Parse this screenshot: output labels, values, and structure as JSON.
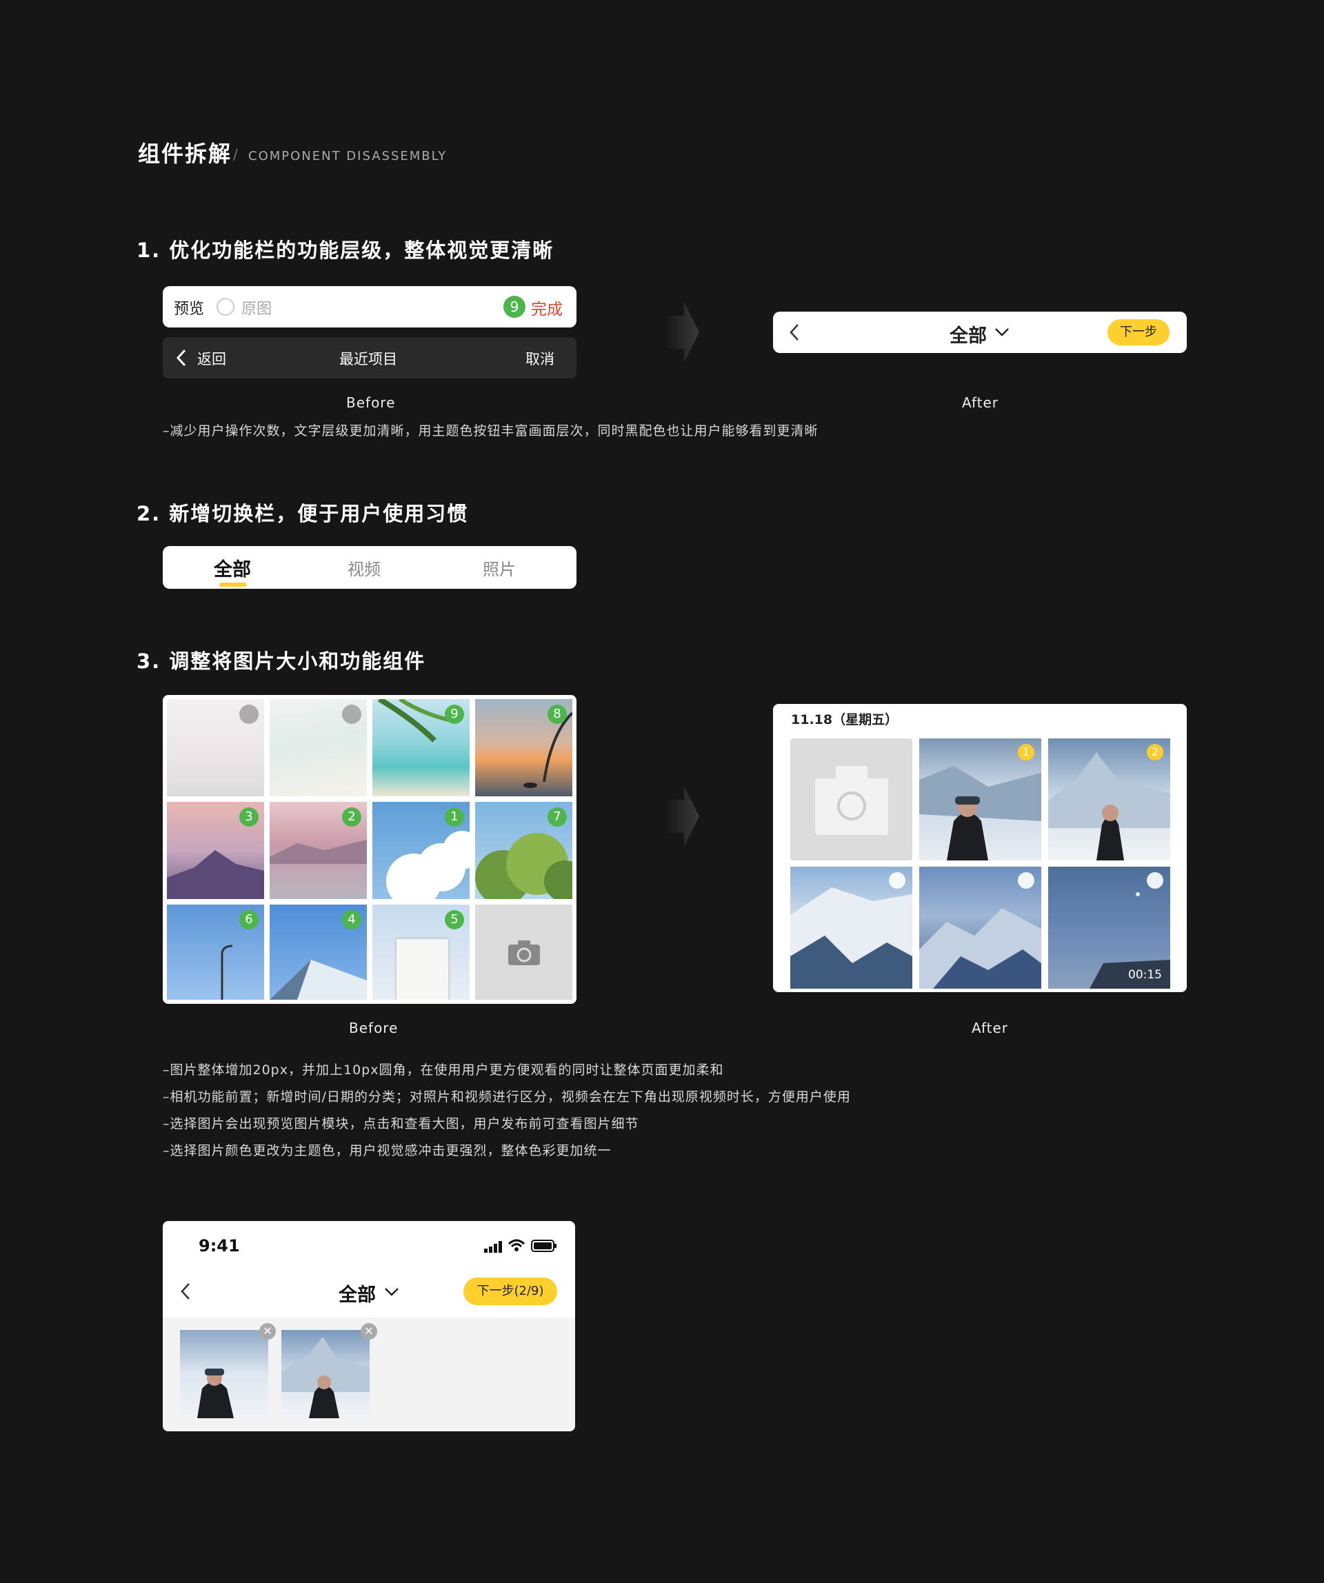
{
  "header": {
    "title": "组件拆解",
    "slash": "/",
    "subtitle": "COMPONENT DISASSEMBLY"
  },
  "section1": {
    "heading": "1. 优化功能栏的功能层级，整体视觉更清晰",
    "before": {
      "preview": "预览",
      "original": "原图",
      "count": "9",
      "done": "完成",
      "back": "返回",
      "recent": "最近项目",
      "cancel": "取消"
    },
    "after": {
      "title": "全部",
      "next": "下一步"
    },
    "before_caption": "Before",
    "after_caption": "After",
    "note": "–减少用户操作次数，文字层级更加清晰，用主题色按钮丰富画面层次，同时黑配色也让用户能够看到更清晰"
  },
  "section2": {
    "heading": "2. 新增切换栏，便于用户使用习惯",
    "tabs": [
      "全部",
      "视频",
      "照片"
    ]
  },
  "section3": {
    "heading": "3. 调整将图片大小和功能组件",
    "before_badges": [
      "",
      "",
      "9",
      "8",
      "3",
      "2",
      "1",
      "7",
      "6",
      "4",
      "5",
      ""
    ],
    "after": {
      "date": "11.18（星期五）",
      "badges": [
        "1",
        "2"
      ],
      "duration": "00:15"
    },
    "before_caption": "Before",
    "after_caption": "After",
    "notes": [
      "–图片整体增加20px，并加上10px圆角，在使用用户更方便观看的同时让整体页面更加柔和",
      "–相机功能前置；新增时间/日期的分类；对照片和视频进行区分，视频会在左下角出现原视频时长，方便用户使用",
      "–选择图片会出现预览图片模块，点击和查看大图，用户发布前可查看图片细节",
      "–选择图片颜色更改为主题色，用户视觉感冲击更强烈，整体色彩更加统一"
    ]
  },
  "phone": {
    "time": "9:41",
    "title": "全部",
    "next": "下一步(2/9)"
  },
  "colors": {
    "accent": "#ffcf2e",
    "green": "#4cb64a",
    "background": "#161616",
    "done_red": "#e0452e"
  }
}
